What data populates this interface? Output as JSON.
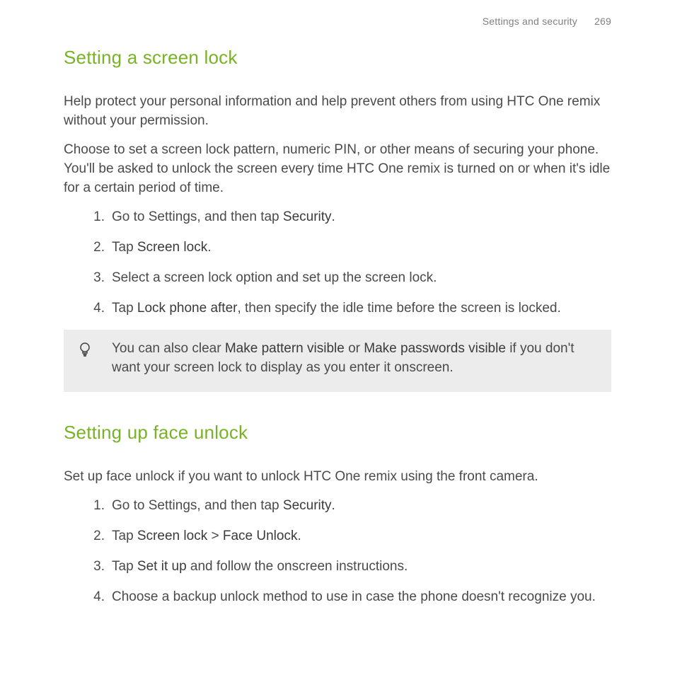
{
  "header": {
    "section_name": "Settings and security",
    "page_number": "269"
  },
  "section1": {
    "title": "Setting a screen lock",
    "intro1": "Help protect your personal information and help prevent others from using HTC One remix without your permission.",
    "intro2": "Choose to set a screen lock pattern, numeric PIN, or other means of securing your phone. You'll be asked to unlock the screen every time HTC One remix is turned on or when it's idle for a certain period of time.",
    "steps": [
      {
        "n": "1.",
        "pre": "Go to Settings, and then tap ",
        "b1": "Security",
        "post": "."
      },
      {
        "n": "2.",
        "pre": "Tap ",
        "b1": "Screen lock",
        "post": "."
      },
      {
        "n": "3.",
        "pre": "Select a screen lock option and set up the screen lock.",
        "b1": "",
        "post": ""
      },
      {
        "n": "4.",
        "pre": "Tap ",
        "b1": "Lock phone after",
        "post": ", then specify the idle time before the screen is locked."
      }
    ],
    "tip": {
      "pre": "You can also clear ",
      "b1": "Make pattern visible",
      "mid": " or ",
      "b2": "Make passwords visible",
      "post": " if you don't want your screen lock to display as you enter it onscreen."
    }
  },
  "section2": {
    "title": "Setting up face unlock",
    "intro": "Set up face unlock if you want to unlock HTC One remix using the front camera.",
    "steps": [
      {
        "n": "1.",
        "pre": "Go to Settings, and then tap ",
        "b1": "Security",
        "mid": "",
        "b2": "",
        "post": "."
      },
      {
        "n": "2.",
        "pre": "Tap ",
        "b1": "Screen lock",
        "mid": " > ",
        "b2": "Face Unlock",
        "post": "."
      },
      {
        "n": "3.",
        "pre": "Tap ",
        "b1": "Set it up",
        "mid": "",
        "b2": "",
        "post": " and follow the onscreen instructions."
      },
      {
        "n": "4.",
        "pre": "Choose a backup unlock method to use in case the phone doesn't recognize you.",
        "b1": "",
        "mid": "",
        "b2": "",
        "post": ""
      }
    ]
  }
}
